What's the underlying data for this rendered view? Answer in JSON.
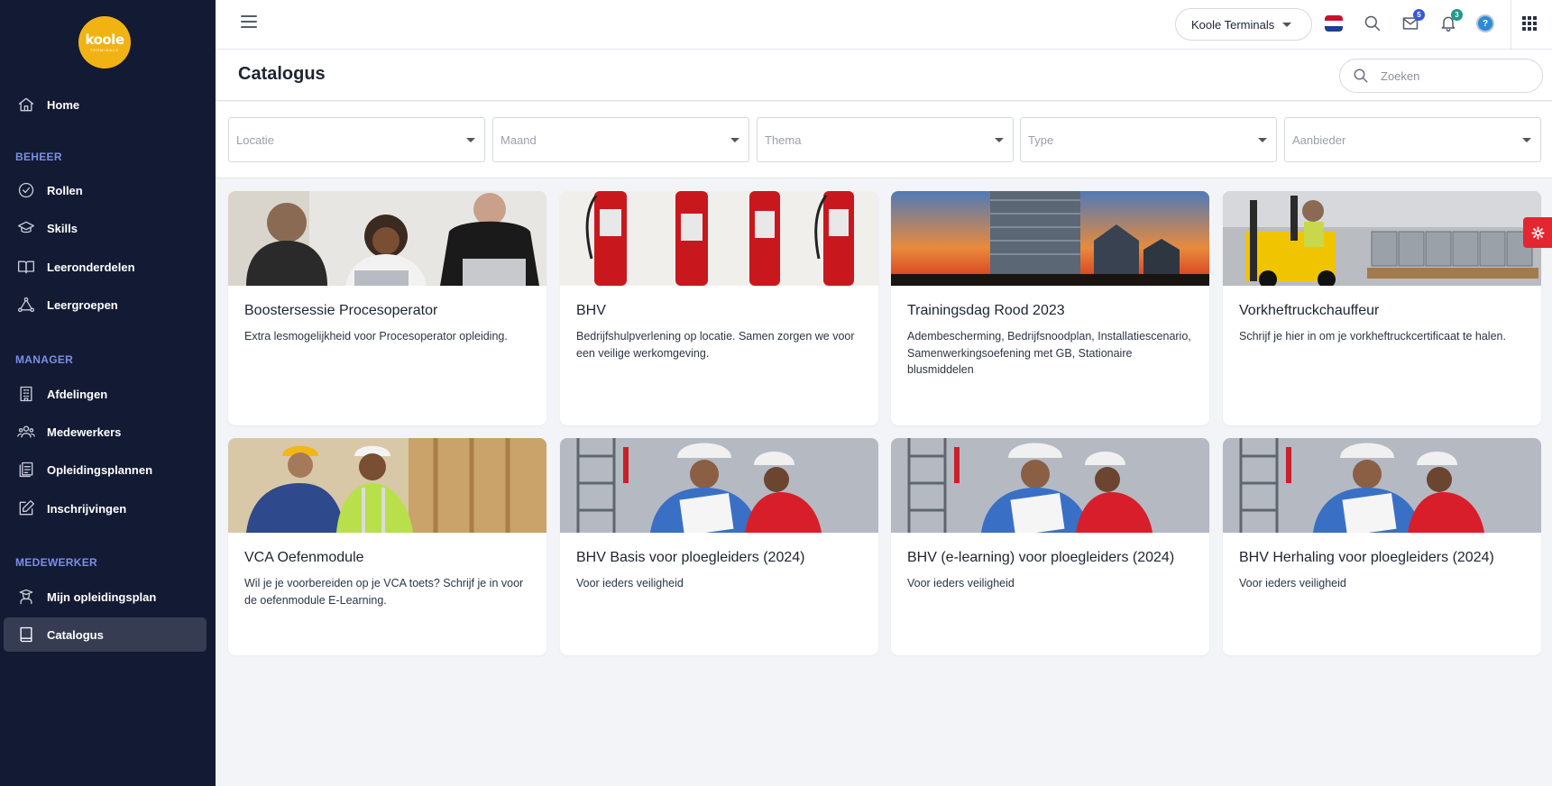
{
  "sidebar": {
    "logo_text": "koole",
    "logo_sub": "TERMINALS",
    "home": "Home",
    "sections": {
      "beheer": "BEHEER",
      "manager": "MANAGER",
      "medewerker": "MEDEWERKER"
    },
    "beheer_items": [
      "Rollen",
      "Skills",
      "Leeronderdelen",
      "Leergroepen"
    ],
    "manager_items": [
      "Afdelingen",
      "Medewerkers",
      "Opleidingsplannen",
      "Inschrijvingen"
    ],
    "medewerker_items": [
      "Mijn opleidingsplan",
      "Catalogus"
    ],
    "active_item": "Catalogus"
  },
  "topbar": {
    "organization": "Koole Terminals",
    "messages_count": "5",
    "notifications_count": "3",
    "avatar_letter": "?",
    "icons": [
      "menu-icon",
      "netherlands-flag-icon",
      "search-icon",
      "inbox-icon",
      "bell-icon",
      "avatar",
      "apps-grid-icon"
    ]
  },
  "page": {
    "title": "Catalogus",
    "search_placeholder": "Zoeken"
  },
  "filters": [
    "Locatie",
    "Maand",
    "Thema",
    "Type",
    "Aanbieder"
  ],
  "cards": [
    {
      "title": "Boostersessie Procesoperator",
      "desc": "Extra lesmogelijkheid voor Procesoperator opleiding.",
      "image": "people-at-laptop"
    },
    {
      "title": "BHV",
      "desc": "Bedrijfshulpverlening op locatie. Samen zorgen we voor een veilige werkomgeving.",
      "image": "fire-extinguishers"
    },
    {
      "title": "Trainingsdag Rood 2023",
      "desc": "Adembescherming, Bedrijfsnoodplan, Installatiescenario, Samenwerkingsoefening met GB, Stationaire blusmiddelen",
      "image": "silos-sunset"
    },
    {
      "title": "Vorkheftruckchauffeur",
      "desc": "Schrijf je hier in om je vorkheftruckcertificaat te halen.",
      "image": "forklift"
    },
    {
      "title": "VCA Oefenmodule",
      "desc": "Wil je je voorbereiden op je VCA toets? Schrijf je in voor de oefenmodule E-Learning.",
      "image": "workers-helmets"
    },
    {
      "title": "BHV Basis voor ploegleiders (2024)",
      "desc": "Voor ieders veiligheid",
      "image": "workers-checklist"
    },
    {
      "title": "BHV (e-learning) voor ploegleiders (2024)",
      "desc": "Voor ieders veiligheid",
      "image": "workers-checklist"
    },
    {
      "title": "BHV Herhaling voor ploegleiders (2024)",
      "desc": "Voor ieders veiligheid",
      "image": "workers-checklist"
    }
  ],
  "colors": {
    "sidebar_bg": "#131a33",
    "section_label": "#7b8fe6",
    "logo": "#f1b314",
    "badge_blue": "#3a57d6",
    "badge_green": "#1f9a88",
    "settings_tab": "#e3262f"
  }
}
